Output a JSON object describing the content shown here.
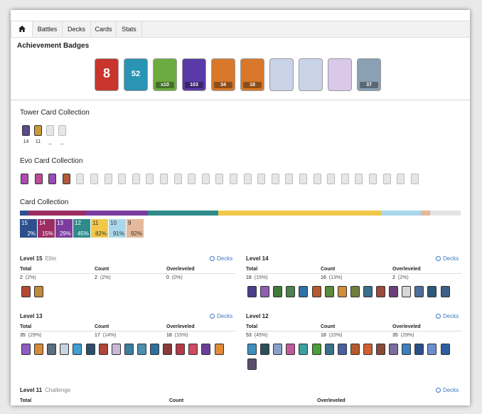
{
  "nav": {
    "home_icon": "home-icon",
    "tabs": [
      {
        "label": "Battles"
      },
      {
        "label": "Decks"
      },
      {
        "label": "Cards"
      },
      {
        "label": "Stats"
      }
    ]
  },
  "achievements": {
    "title": "Achievement Badges",
    "badges": [
      {
        "label": "8",
        "color": "#c8352d"
      },
      {
        "label": "52",
        "color": "#2a94b5"
      },
      {
        "label": "x10",
        "color": "#6cab3f"
      },
      {
        "label": "103",
        "color": "#5a3aa8"
      },
      {
        "label": "34",
        "color": "#d9782a"
      },
      {
        "label": "18",
        "color": "#d9782a"
      },
      {
        "label": "",
        "color": "#c9d3e8"
      },
      {
        "label": "",
        "color": "#c9d3e8"
      },
      {
        "label": "",
        "color": "#d9c8e8"
      },
      {
        "label": "37",
        "color": "#8aa0b4"
      }
    ]
  },
  "tower_collection": {
    "title": "Tower Card Collection",
    "items": [
      {
        "count": "14"
      },
      {
        "count": "11"
      },
      {
        "count": "_"
      },
      {
        "count": "_"
      }
    ]
  },
  "evo_collection": {
    "title": "Evo Card Collection",
    "owned": 4,
    "total": 29
  },
  "card_collection": {
    "title": "Card Collection",
    "levels": [
      {
        "level": "15",
        "pct": "2%",
        "color": "#2d4f8e",
        "text": "#ffffff"
      },
      {
        "level": "14",
        "pct": "15%",
        "color": "#9b2d63",
        "text": "#ffffff"
      },
      {
        "level": "13",
        "pct": "29%",
        "color": "#7b3c9e",
        "text": "#ffffff"
      },
      {
        "level": "12",
        "pct": "45%",
        "color": "#2e8b8a",
        "text": "#ffffff"
      },
      {
        "level": "11",
        "pct": "82%",
        "color": "#f2c84b",
        "text": "#333333"
      },
      {
        "level": "10",
        "pct": "91%",
        "color": "#a9d8ec",
        "text": "#333333"
      },
      {
        "level": "9",
        "pct": "92%",
        "color": "#e4b89a",
        "text": "#333333"
      }
    ],
    "bar": [
      {
        "fraction": 0.02,
        "color": "#2d4f8e"
      },
      {
        "fraction": 0.13,
        "color": "#9b2d63"
      },
      {
        "fraction": 0.14,
        "color": "#7b3c9e"
      },
      {
        "fraction": 0.16,
        "color": "#2e8b8a"
      },
      {
        "fraction": 0.37,
        "color": "#f2c84b"
      },
      {
        "fraction": 0.09,
        "color": "#a9d8ec"
      },
      {
        "fraction": 0.02,
        "color": "#e4b89a"
      },
      {
        "fraction": 0.07,
        "color": "#e3e3e3"
      }
    ]
  },
  "level_groups": [
    {
      "title": "Level 15",
      "sub": "Elite",
      "decks": "Decks",
      "total_label": "Total",
      "count_label": "Count",
      "over_label": "Overleveled",
      "total": "2",
      "total_pct": "(2%)",
      "count": "2",
      "count_pct": "(2%)",
      "over": "0",
      "over_pct": "(0%)",
      "cards": [
        "#b24a2f",
        "#c08a3c"
      ]
    },
    {
      "title": "Level 14",
      "sub": "",
      "decks": "Decks",
      "total_label": "Total",
      "count_label": "Count",
      "over_label": "Overleveled",
      "total": "18",
      "total_pct": "(15%)",
      "count": "16",
      "count_pct": "(13%)",
      "over": "2",
      "over_pct": "(2%)",
      "cards": [
        "#4a3f8a",
        "#8d5fb0",
        "#3f7a3a",
        "#4e7f4d",
        "#2b72a8",
        "#b35a2e",
        "#5a8a3a",
        "#d28c3a",
        "#6f7f3d",
        "#3b6f8f",
        "#9c4a3c",
        "#6b3f7a",
        "#d7d7d7",
        "#4c6f9a",
        "#2d5a7a",
        "#3e5f8a"
      ]
    },
    {
      "title": "Level 13",
      "sub": "",
      "decks": "Decks",
      "total_label": "Total",
      "count_label": "Count",
      "over_label": "Overleveled",
      "total": "35",
      "total_pct": "(29%)",
      "count": "17",
      "count_pct": "(14%)",
      "over": "18",
      "over_pct": "(15%)",
      "cards": [
        "#8e5fc0",
        "#d88a3a",
        "#5a6f7f",
        "#c7d4e0",
        "#3f9fd4",
        "#2d4f6a",
        "#b0453a",
        "#c7b8d8",
        "#3b7fa0",
        "#4d8fb0",
        "#2f6f9f",
        "#8a3a3a",
        "#b53a4a",
        "#d04a60",
        "#6a3f9a",
        "#e08a3a"
      ]
    },
    {
      "title": "Level 12",
      "sub": "",
      "decks": "Decks",
      "total_label": "Total",
      "count_label": "Count",
      "over_label": "Overleveled",
      "total": "53",
      "total_pct": "(45%)",
      "count": "18",
      "count_pct": "(15%)",
      "over": "35",
      "over_pct": "(29%)",
      "cards": [
        "#3f8fbf",
        "#2d4f5a",
        "#8aa0c8",
        "#c05a9a",
        "#3aa0a0",
        "#4a9f3a",
        "#3b6f8a",
        "#4a5fa0",
        "#b35a2e",
        "#d0602e",
        "#8a4a3a",
        "#7a6f9f",
        "#3a7fbf",
        "#2a4f8a",
        "#6a8fd0",
        "#2d5fa0",
        "#5a4f6a"
      ]
    },
    {
      "title": "Level 11",
      "sub": "Challenge",
      "decks": "Decks",
      "total_label": "Total",
      "count_label": "Count",
      "over_label": "Overleveled"
    }
  ]
}
